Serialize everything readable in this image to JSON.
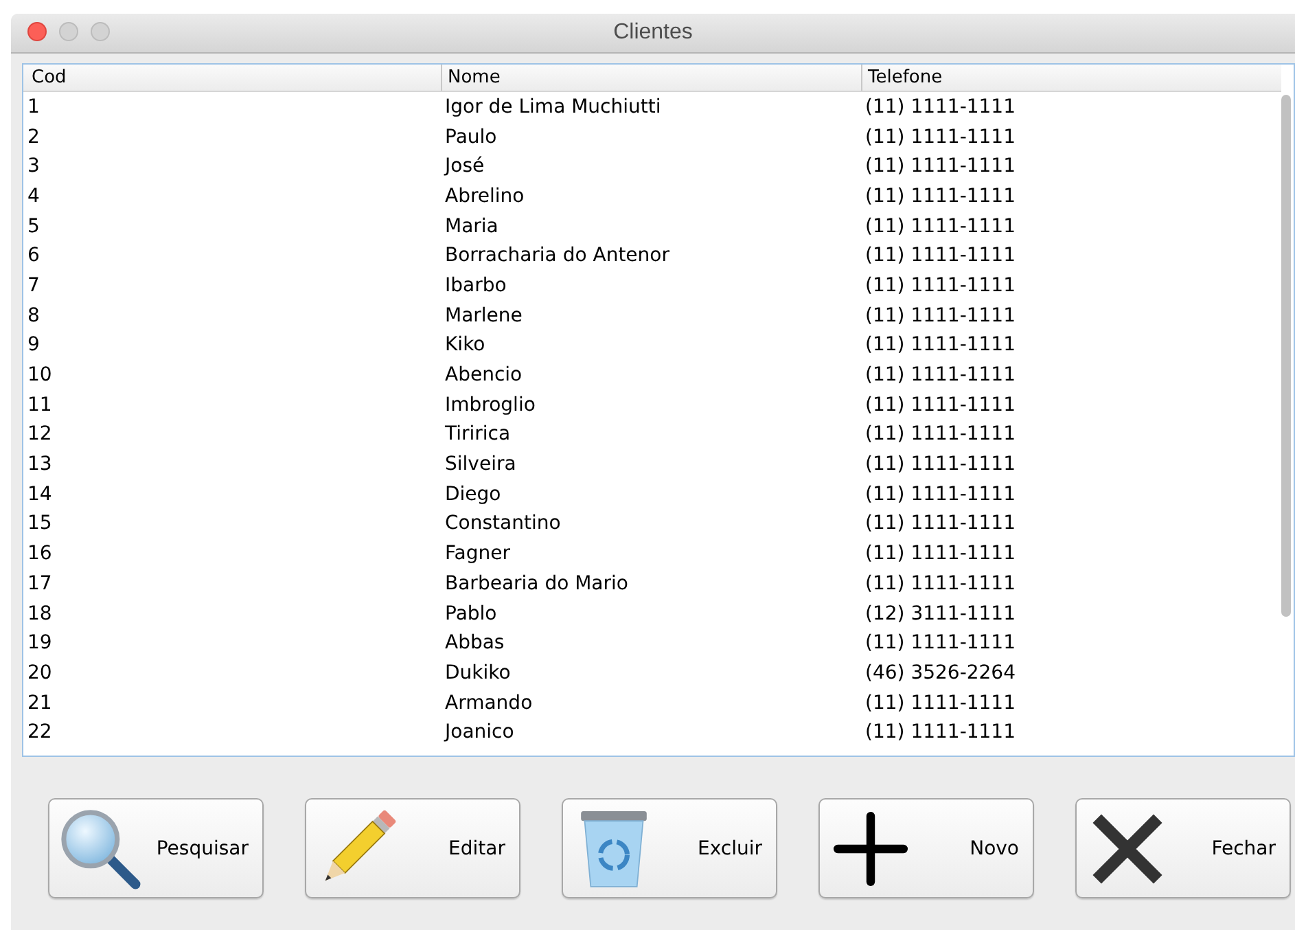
{
  "window": {
    "title": "Clientes"
  },
  "table": {
    "columns": [
      "Cod",
      "Nome",
      "Telefone"
    ],
    "rows": [
      [
        "1",
        "Igor de Lima Muchiutti",
        "(11) 1111-1111"
      ],
      [
        "2",
        "Paulo",
        "(11) 1111-1111"
      ],
      [
        "3",
        "José",
        "(11) 1111-1111"
      ],
      [
        "4",
        "Abrelino",
        "(11) 1111-1111"
      ],
      [
        "5",
        "Maria",
        "(11) 1111-1111"
      ],
      [
        "6",
        "Borracharia do Antenor",
        "(11) 1111-1111"
      ],
      [
        "7",
        "Ibarbo",
        "(11) 1111-1111"
      ],
      [
        "8",
        "Marlene",
        "(11) 1111-1111"
      ],
      [
        "9",
        "Kiko",
        "(11) 1111-1111"
      ],
      [
        "10",
        "Abencio",
        "(11) 1111-1111"
      ],
      [
        "11",
        "Imbroglio",
        "(11) 1111-1111"
      ],
      [
        "12",
        "Tiririca",
        "(11) 1111-1111"
      ],
      [
        "13",
        "Silveira",
        "(11) 1111-1111"
      ],
      [
        "14",
        "Diego",
        "(11) 1111-1111"
      ],
      [
        "15",
        "Constantino",
        "(11) 1111-1111"
      ],
      [
        "16",
        "Fagner",
        "(11) 1111-1111"
      ],
      [
        "17",
        "Barbearia do Mario",
        "(11) 1111-1111"
      ],
      [
        "18",
        "Pablo",
        "(12) 3111-1111"
      ],
      [
        "19",
        "Abbas",
        "(11) 1111-1111"
      ],
      [
        "20",
        "Dukiko",
        "(46) 3526-2264"
      ],
      [
        "21",
        "Armando",
        "(11) 1111-1111"
      ],
      [
        "22",
        "Joanico",
        "(11) 1111-1111"
      ]
    ]
  },
  "buttons": [
    {
      "label": "Pesquisar",
      "kind": "search"
    },
    {
      "label": "Editar",
      "kind": "edit"
    },
    {
      "label": "Excluir",
      "kind": "delete"
    },
    {
      "label": "Novo",
      "kind": "new"
    },
    {
      "label": "Fechar",
      "kind": "close"
    }
  ]
}
